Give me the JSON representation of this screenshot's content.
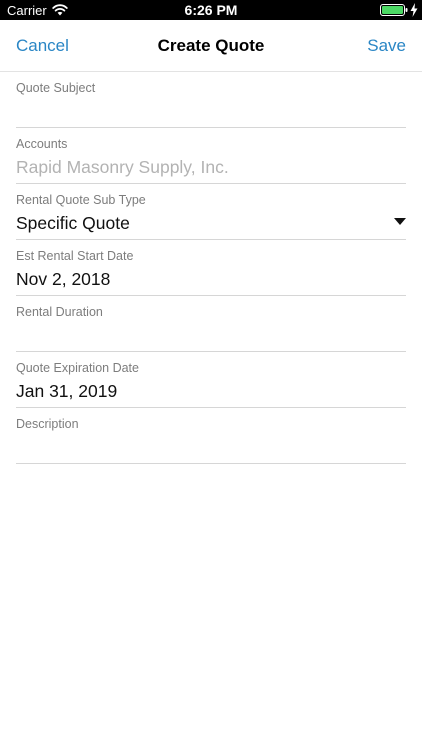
{
  "status_bar": {
    "carrier": "Carrier",
    "time": "6:26 PM",
    "icons": [
      "wifi-icon",
      "battery-icon",
      "charging-bolt-icon"
    ],
    "battery_color": "#4cd964"
  },
  "nav": {
    "cancel_label": "Cancel",
    "title": "Create Quote",
    "save_label": "Save",
    "accent_color": "#2a86c5"
  },
  "form": {
    "fields": [
      {
        "label": "Quote Subject",
        "value": ""
      },
      {
        "label": "Accounts",
        "value": "Rapid Masonry Supply, Inc."
      },
      {
        "label": "Rental Quote Sub Type",
        "value": "Specific Quote",
        "icon": "chevron-down-icon"
      },
      {
        "label": "Est Rental Start Date",
        "value": "Nov 2, 2018"
      },
      {
        "label": "Rental Duration",
        "value": ""
      },
      {
        "label": "Quote Expiration Date",
        "value": "Jan 31, 2019"
      },
      {
        "label": "Description",
        "value": ""
      }
    ]
  }
}
